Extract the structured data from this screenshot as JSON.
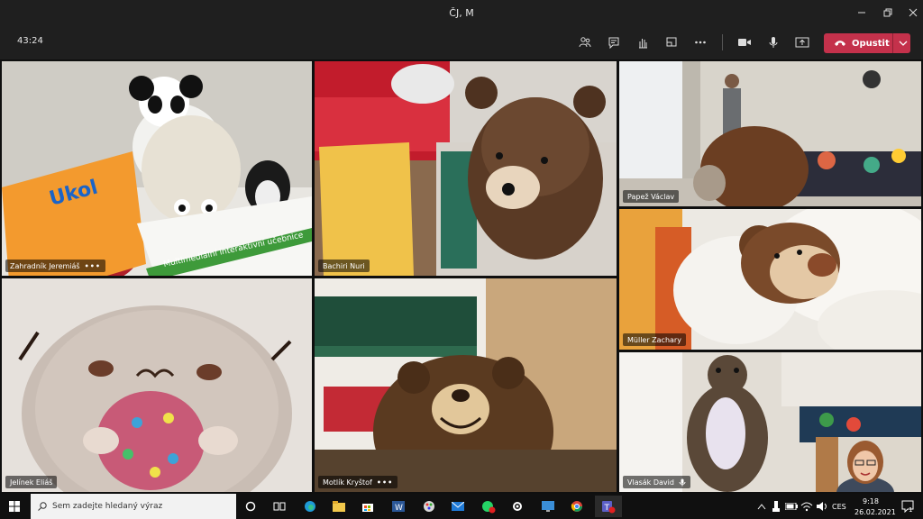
{
  "window": {
    "title": "ČJ, M"
  },
  "meeting": {
    "timer": "43:24",
    "leave_label": "Opustit"
  },
  "participants": [
    {
      "name": "Zahradník Jeremiáš",
      "more": "•••"
    },
    {
      "name": "Bachiri Nuri"
    },
    {
      "name": "Papež Václav"
    },
    {
      "name": "Müller Zachary"
    },
    {
      "name": "Jelínek Eliáš"
    },
    {
      "name": "Motlík Kryštof",
      "more": "•••"
    },
    {
      "name": "Vlasák David"
    }
  ],
  "tile_text": {
    "book": "Multimediální interaktivní učebnice"
  },
  "taskbar": {
    "search_placeholder": "Sem zadejte hledaný výraz"
  },
  "tray": {
    "language": "CES",
    "time": "9:18",
    "date": "26.02.2021",
    "notifications": "1"
  },
  "colors": {
    "leave": "#c4314b",
    "toolbar": "#1f1f1f",
    "taskbar": "#101010"
  }
}
